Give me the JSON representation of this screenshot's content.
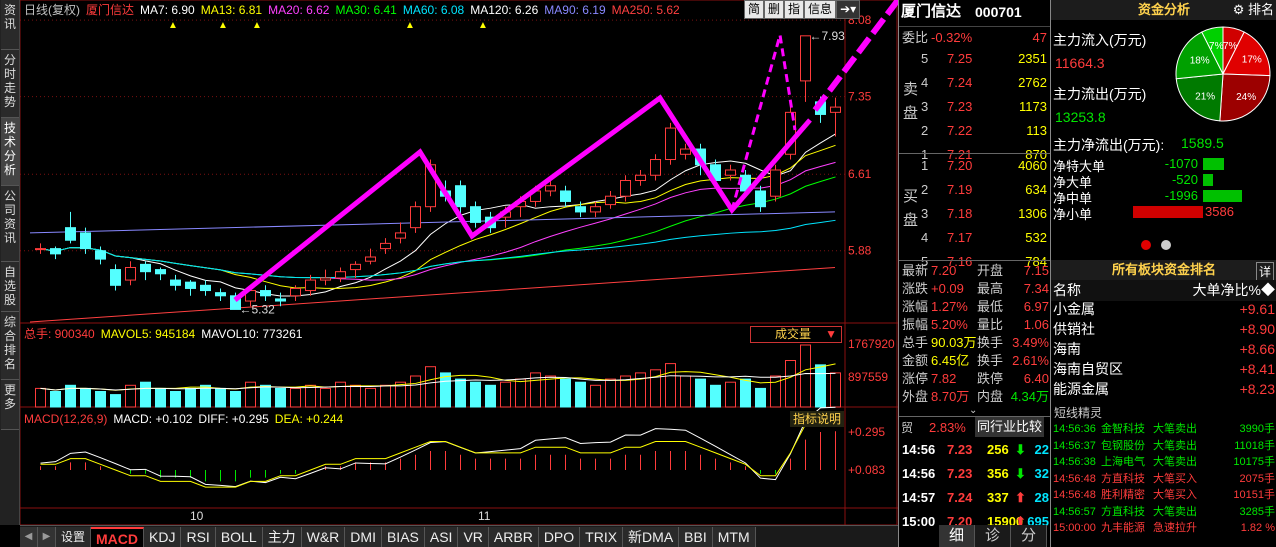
{
  "left_tabs": [
    "资讯",
    "分时走势",
    "技术分析",
    "公司资讯",
    "自选股",
    "综合排名",
    "更多"
  ],
  "ma_line": {
    "period": "日线(复权)",
    "name": "厦门信达",
    "items": [
      {
        "l": "MA7: 6.90",
        "c": "#ffffff"
      },
      {
        "l": "MA13: 6.81",
        "c": "#ffff00"
      },
      {
        "l": "MA20: 6.62",
        "c": "#ff40ff"
      },
      {
        "l": "MA30: 6.41",
        "c": "#00ff00"
      },
      {
        "l": "MA60: 6.08",
        "c": "#00e5ff"
      },
      {
        "l": "MA120: 6.26",
        "c": "#ffffff"
      },
      {
        "l": "MA90: 6.19",
        "c": "#8888ff"
      },
      {
        "l": "MA250: 5.62",
        "c": "#ff4040"
      }
    ]
  },
  "toolbar": [
    "简",
    "删",
    "指",
    "信息"
  ],
  "price_axis": [
    "8.08",
    "7.35",
    "6.61",
    "5.88"
  ],
  "price_high": "7.93",
  "price_low": "5.32",
  "vol_line": {
    "total": "总手: 900340",
    "mavol5": "MAVOL5: 945184",
    "mavol10": "MAVOL10: 773261"
  },
  "vol_axis": [
    "1767920",
    "897559"
  ],
  "vol_select": "成交量",
  "macd_line": {
    "m": "MACD(12,26,9)",
    "macd": "MACD: +0.102",
    "diff": "DIFF: +0.295",
    "dea": "DEA: +0.244"
  },
  "macd_axis": [
    "+0.295",
    "+0.083"
  ],
  "macd_btn": "指标说明",
  "date_labels": [
    "10",
    "11"
  ],
  "bottom_tabs": [
    "设置",
    "MACD",
    "KDJ",
    "RSI",
    "BOLL",
    "主力",
    "W&R",
    "DMI",
    "BIAS",
    "ASI",
    "VR",
    "ARBR",
    "DPO",
    "TRIX",
    "新DMA",
    "BBI",
    "MTM"
  ],
  "chart_data": {
    "type": "candlestick",
    "title": "厦门信达 日线(复权)",
    "ylim": [
      5.2,
      8.1
    ],
    "high_marker": 7.93,
    "low_marker": 5.32,
    "candles": [
      [
        5.9,
        5.9,
        5.95,
        5.85
      ],
      [
        5.9,
        5.85,
        5.92,
        5.8
      ],
      [
        6.1,
        5.98,
        6.25,
        5.95
      ],
      [
        6.05,
        5.9,
        6.1,
        5.85
      ],
      [
        5.88,
        5.8,
        5.92,
        5.75
      ],
      [
        5.7,
        5.55,
        5.75,
        5.5
      ],
      [
        5.6,
        5.72,
        5.78,
        5.55
      ],
      [
        5.75,
        5.68,
        5.78,
        5.6
      ],
      [
        5.7,
        5.66,
        5.72,
        5.6
      ],
      [
        5.6,
        5.55,
        5.65,
        5.5
      ],
      [
        5.58,
        5.52,
        5.6,
        5.45
      ],
      [
        5.55,
        5.5,
        5.6,
        5.45
      ],
      [
        5.48,
        5.45,
        5.52,
        5.4
      ],
      [
        5.45,
        5.32,
        5.48,
        5.32
      ],
      [
        5.4,
        5.5,
        5.55,
        5.35
      ],
      [
        5.5,
        5.45,
        5.55,
        5.4
      ],
      [
        5.42,
        5.4,
        5.48,
        5.35
      ],
      [
        5.45,
        5.52,
        5.55,
        5.4
      ],
      [
        5.5,
        5.6,
        5.65,
        5.45
      ],
      [
        5.6,
        5.62,
        5.7,
        5.55
      ],
      [
        5.62,
        5.68,
        5.72,
        5.58
      ],
      [
        5.7,
        5.75,
        5.78,
        5.62
      ],
      [
        5.78,
        5.82,
        5.9,
        5.75
      ],
      [
        5.9,
        5.95,
        6.0,
        5.85
      ],
      [
        6.0,
        6.05,
        6.15,
        5.95
      ],
      [
        6.1,
        6.3,
        6.35,
        6.05
      ],
      [
        6.3,
        6.7,
        6.75,
        6.25
      ],
      [
        6.45,
        6.4,
        6.55,
        6.35
      ],
      [
        6.5,
        6.3,
        6.55,
        6.2
      ],
      [
        6.3,
        6.15,
        6.35,
        6.1
      ],
      [
        6.2,
        6.1,
        6.25,
        6.05
      ],
      [
        6.2,
        6.25,
        6.3,
        6.1
      ],
      [
        6.3,
        6.35,
        6.4,
        6.2
      ],
      [
        6.35,
        6.45,
        6.5,
        6.3
      ],
      [
        6.45,
        6.5,
        6.55,
        6.4
      ],
      [
        6.45,
        6.35,
        6.5,
        6.3
      ],
      [
        6.3,
        6.25,
        6.35,
        6.2
      ],
      [
        6.25,
        6.3,
        6.35,
        6.2
      ],
      [
        6.32,
        6.4,
        6.45,
        6.28
      ],
      [
        6.4,
        6.55,
        6.6,
        6.35
      ],
      [
        6.55,
        6.6,
        6.65,
        6.5
      ],
      [
        6.6,
        6.75,
        6.8,
        6.55
      ],
      [
        6.75,
        7.05,
        7.1,
        6.7
      ],
      [
        6.8,
        6.85,
        6.9,
        6.75
      ],
      [
        6.85,
        6.7,
        6.9,
        6.6
      ],
      [
        6.7,
        6.55,
        6.75,
        6.5
      ],
      [
        6.6,
        6.65,
        6.7,
        6.55
      ],
      [
        6.6,
        6.45,
        6.65,
        6.4
      ],
      [
        6.45,
        6.3,
        6.5,
        6.25
      ],
      [
        6.4,
        6.65,
        6.7,
        6.35
      ],
      [
        6.8,
        7.2,
        7.25,
        6.75
      ],
      [
        7.5,
        7.93,
        7.93,
        7.3
      ],
      [
        7.3,
        7.18,
        7.35,
        7.1
      ],
      [
        7.2,
        7.25,
        7.34,
        6.97
      ]
    ],
    "volume": [
      0.3,
      0.25,
      0.35,
      0.3,
      0.25,
      0.2,
      0.35,
      0.4,
      0.3,
      0.25,
      0.3,
      0.35,
      0.3,
      0.25,
      0.4,
      0.35,
      0.3,
      0.3,
      0.35,
      0.3,
      0.4,
      0.35,
      0.3,
      0.35,
      0.4,
      0.5,
      0.65,
      0.55,
      0.45,
      0.4,
      0.35,
      0.4,
      0.45,
      0.55,
      0.5,
      0.45,
      0.4,
      0.35,
      0.45,
      0.5,
      0.55,
      0.6,
      0.7,
      0.5,
      0.45,
      0.35,
      0.4,
      0.45,
      0.3,
      0.5,
      0.75,
      1.0,
      0.68,
      0.55
    ],
    "macd": [
      0.01,
      0.01,
      0.02,
      0.02,
      0.01,
      0.0,
      -0.01,
      -0.01,
      -0.02,
      -0.02,
      -0.02,
      -0.03,
      -0.03,
      -0.03,
      -0.02,
      -0.02,
      -0.01,
      -0.01,
      0.0,
      0.01,
      0.01,
      0.02,
      0.02,
      0.02,
      0.03,
      0.04,
      0.05,
      0.05,
      0.04,
      0.03,
      0.03,
      0.03,
      0.03,
      0.04,
      0.04,
      0.04,
      0.03,
      0.03,
      0.03,
      0.04,
      0.04,
      0.05,
      0.05,
      0.05,
      0.04,
      0.03,
      0.02,
      0.01,
      -0.01,
      -0.01,
      0.03,
      0.08,
      0.1,
      0.102
    ]
  },
  "quote": {
    "name": "厦门信达",
    "code": "000701",
    "weibi_label": "委比",
    "weibi": "-0.32%",
    "weicha": "47",
    "sell_label": "卖盘",
    "buy_label": "买盘",
    "sell": [
      {
        "n": "5",
        "p": "7.25",
        "v": "2351"
      },
      {
        "n": "4",
        "p": "7.24",
        "v": "2762"
      },
      {
        "n": "3",
        "p": "7.23",
        "v": "1173"
      },
      {
        "n": "2",
        "p": "7.22",
        "v": "113"
      },
      {
        "n": "1",
        "p": "7.21",
        "v": "870"
      }
    ],
    "buy": [
      {
        "n": "1",
        "p": "7.20",
        "v": "4060"
      },
      {
        "n": "2",
        "p": "7.19",
        "v": "634"
      },
      {
        "n": "3",
        "p": "7.18",
        "v": "1306"
      },
      {
        "n": "4",
        "p": "7.17",
        "v": "532"
      },
      {
        "n": "5",
        "p": "7.16",
        "v": "784"
      }
    ],
    "stats": [
      [
        "最新",
        "7.20",
        "开盘",
        "7.15"
      ],
      [
        "涨跌",
        "+0.09",
        "最高",
        "7.34"
      ],
      [
        "涨幅",
        "1.27%",
        "最低",
        "6.97"
      ],
      [
        "振幅",
        "5.20%",
        "量比",
        "1.06"
      ],
      [
        "总手",
        "90.03万",
        "换手",
        "3.49%"
      ],
      [
        "金额",
        "6.45亿",
        "换手",
        "2.61%"
      ],
      [
        "涨停",
        "7.82",
        "跌停",
        "6.40"
      ],
      [
        "外盘",
        "8.70万",
        "内盘",
        "4.34万"
      ]
    ],
    "compare_label": "贸",
    "compare_pct": "2.83%",
    "compare_btn": "同行业比较",
    "ticks": [
      [
        "14:56",
        "7.23",
        "256",
        "22",
        "up"
      ],
      [
        "14:56",
        "7.23",
        "356",
        "32",
        "up"
      ],
      [
        "14:57",
        "7.24",
        "337",
        "28",
        "down"
      ],
      [
        "15:00",
        "7.20",
        "15900",
        "695",
        "down"
      ]
    ],
    "tabs": [
      "细",
      "诊",
      "分"
    ]
  },
  "fund": {
    "title": "资金分析",
    "rank_btn": "排名",
    "inflow_label": "主力流入(万元)",
    "inflow": "11664.3",
    "outflow_label": "主力流出(万元)",
    "outflow": "13253.8",
    "net_label": "主力净流出(万元):",
    "net": "1589.5",
    "pie": [
      {
        "l": "7%",
        "v": 7,
        "c": "#d00000"
      },
      {
        "l": "17%",
        "v": 17,
        "c": "#e00000"
      },
      {
        "l": "24%",
        "v": 24,
        "c": "#9c0000"
      },
      {
        "l": "21%",
        "v": 21,
        "c": "#007a00"
      },
      {
        "l": "18%",
        "v": 18,
        "c": "#00a000"
      },
      {
        "l": "7%",
        "v": 7,
        "c": "#00d000"
      }
    ],
    "flows": [
      {
        "l": "净特大单",
        "v": "-1070",
        "n": -1070
      },
      {
        "l": "净大单",
        "v": "-520",
        "n": -520
      },
      {
        "l": "净中单",
        "v": "-1996",
        "n": -1996
      },
      {
        "l": "净小单",
        "v": "3586",
        "n": 3586
      }
    ],
    "board_title": "所有板块资金排名",
    "board_btn": "详",
    "col_name": "名称",
    "col_val": "大单净比%",
    "boards": [
      [
        "小金属",
        "+9.61"
      ],
      [
        "供销社",
        "+8.90"
      ],
      [
        "海南",
        "+8.66"
      ],
      [
        "海南自贸区",
        "+8.41"
      ],
      [
        "能源金属",
        "+8.23"
      ]
    ],
    "jl_title": "短线精灵",
    "msgs": [
      [
        "14:56:36",
        "金智科技",
        "大笔卖出",
        "3990手"
      ],
      [
        "14:56:37",
        "包钢股份",
        "大笔卖出",
        "11018手"
      ],
      [
        "14:56:38",
        "上海电气",
        "大笔卖出",
        "10175手"
      ],
      [
        "14:56:48",
        "方直科技",
        "大笔买入",
        "2075手"
      ],
      [
        "14:56:48",
        "胜利精密",
        "大笔买入",
        "10151手"
      ],
      [
        "14:56:57",
        "方直科技",
        "大笔卖出",
        "3285手"
      ],
      [
        "15:00:00",
        "九丰能源",
        "急速拉升",
        "1.82 %"
      ]
    ]
  }
}
